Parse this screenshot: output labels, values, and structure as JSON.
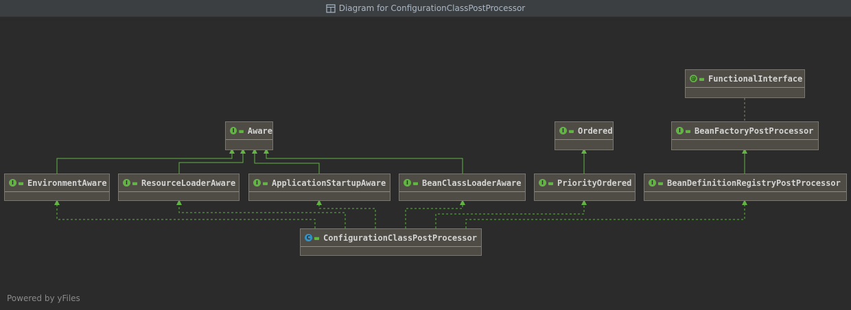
{
  "window": {
    "title": "Diagram for ConfigurationClassPostProcessor"
  },
  "nodes": {
    "functional_interface": {
      "label": "FunctionalInterface",
      "kind": "annotation"
    },
    "aware": {
      "label": "Aware",
      "kind": "interface"
    },
    "ordered": {
      "label": "Ordered",
      "kind": "interface"
    },
    "bean_factory_post_processor": {
      "label": "BeanFactoryPostProcessor",
      "kind": "interface"
    },
    "environment_aware": {
      "label": "EnvironmentAware",
      "kind": "interface"
    },
    "resource_loader_aware": {
      "label": "ResourceLoaderAware",
      "kind": "interface"
    },
    "application_startup_aware": {
      "label": "ApplicationStartupAware",
      "kind": "interface"
    },
    "bean_class_loader_aware": {
      "label": "BeanClassLoaderAware",
      "kind": "interface"
    },
    "priority_ordered": {
      "label": "PriorityOrdered",
      "kind": "interface"
    },
    "bean_definition_registry_post_processor": {
      "label": "BeanDefinitionRegistryPostProcessor",
      "kind": "interface"
    },
    "configuration_class_post_processor": {
      "label": "ConfigurationClassPostProcessor",
      "kind": "class"
    }
  },
  "badges": {
    "interface": "I",
    "class": "C",
    "annotation": "@"
  },
  "colors": {
    "extends_line": "#62b543",
    "implements_line": "#62b543",
    "node_fill": "#4f4c45"
  },
  "footer": "Powered by yFiles"
}
